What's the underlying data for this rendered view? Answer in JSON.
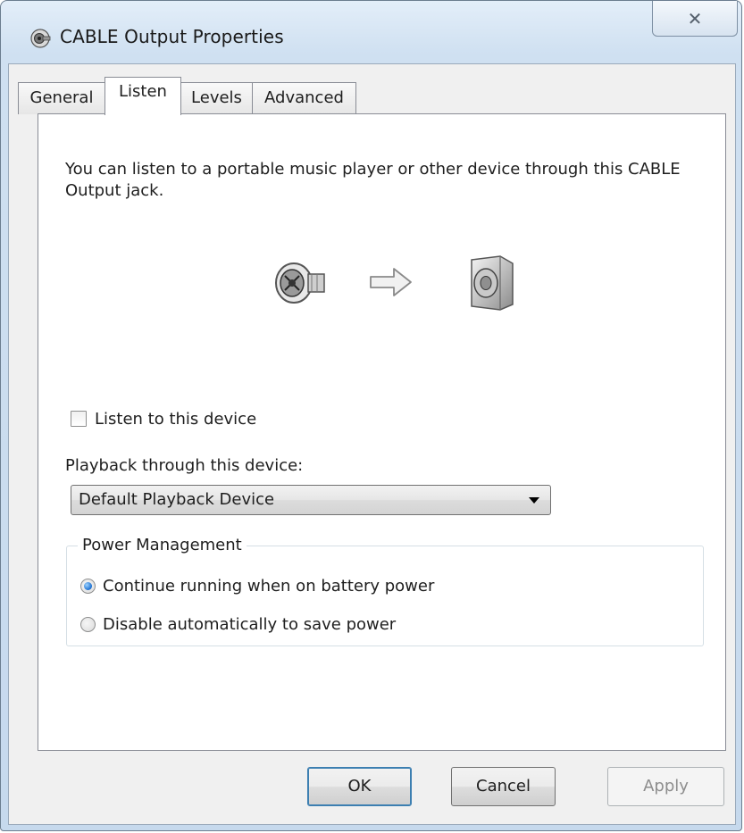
{
  "window": {
    "title": "CABLE Output Properties",
    "close_symbol": "✕"
  },
  "tabs": [
    {
      "label": "General",
      "active": false
    },
    {
      "label": "Listen",
      "active": true
    },
    {
      "label": "Levels",
      "active": false
    },
    {
      "label": "Advanced",
      "active": false
    }
  ],
  "listen": {
    "description": "You can listen to a portable music player or other device through this CABLE Output jack.",
    "source_icon": "audio-jack-icon",
    "arrow_icon": "arrow-right-icon",
    "target_icon": "speaker-icon",
    "listen_checkbox": {
      "label": "Listen to this device",
      "checked": false
    },
    "playback_label": "Playback through this device:",
    "playback_device": "Default Playback Device"
  },
  "power_management": {
    "title": "Power Management",
    "options": [
      {
        "label": "Continue running when on battery power",
        "selected": true
      },
      {
        "label": "Disable automatically to save power",
        "selected": false
      }
    ]
  },
  "buttons": {
    "ok": "OK",
    "cancel": "Cancel",
    "apply": "Apply"
  },
  "colors": {
    "window_frame": "#c6d9ed",
    "radio_selected": "#1b6fd0"
  }
}
